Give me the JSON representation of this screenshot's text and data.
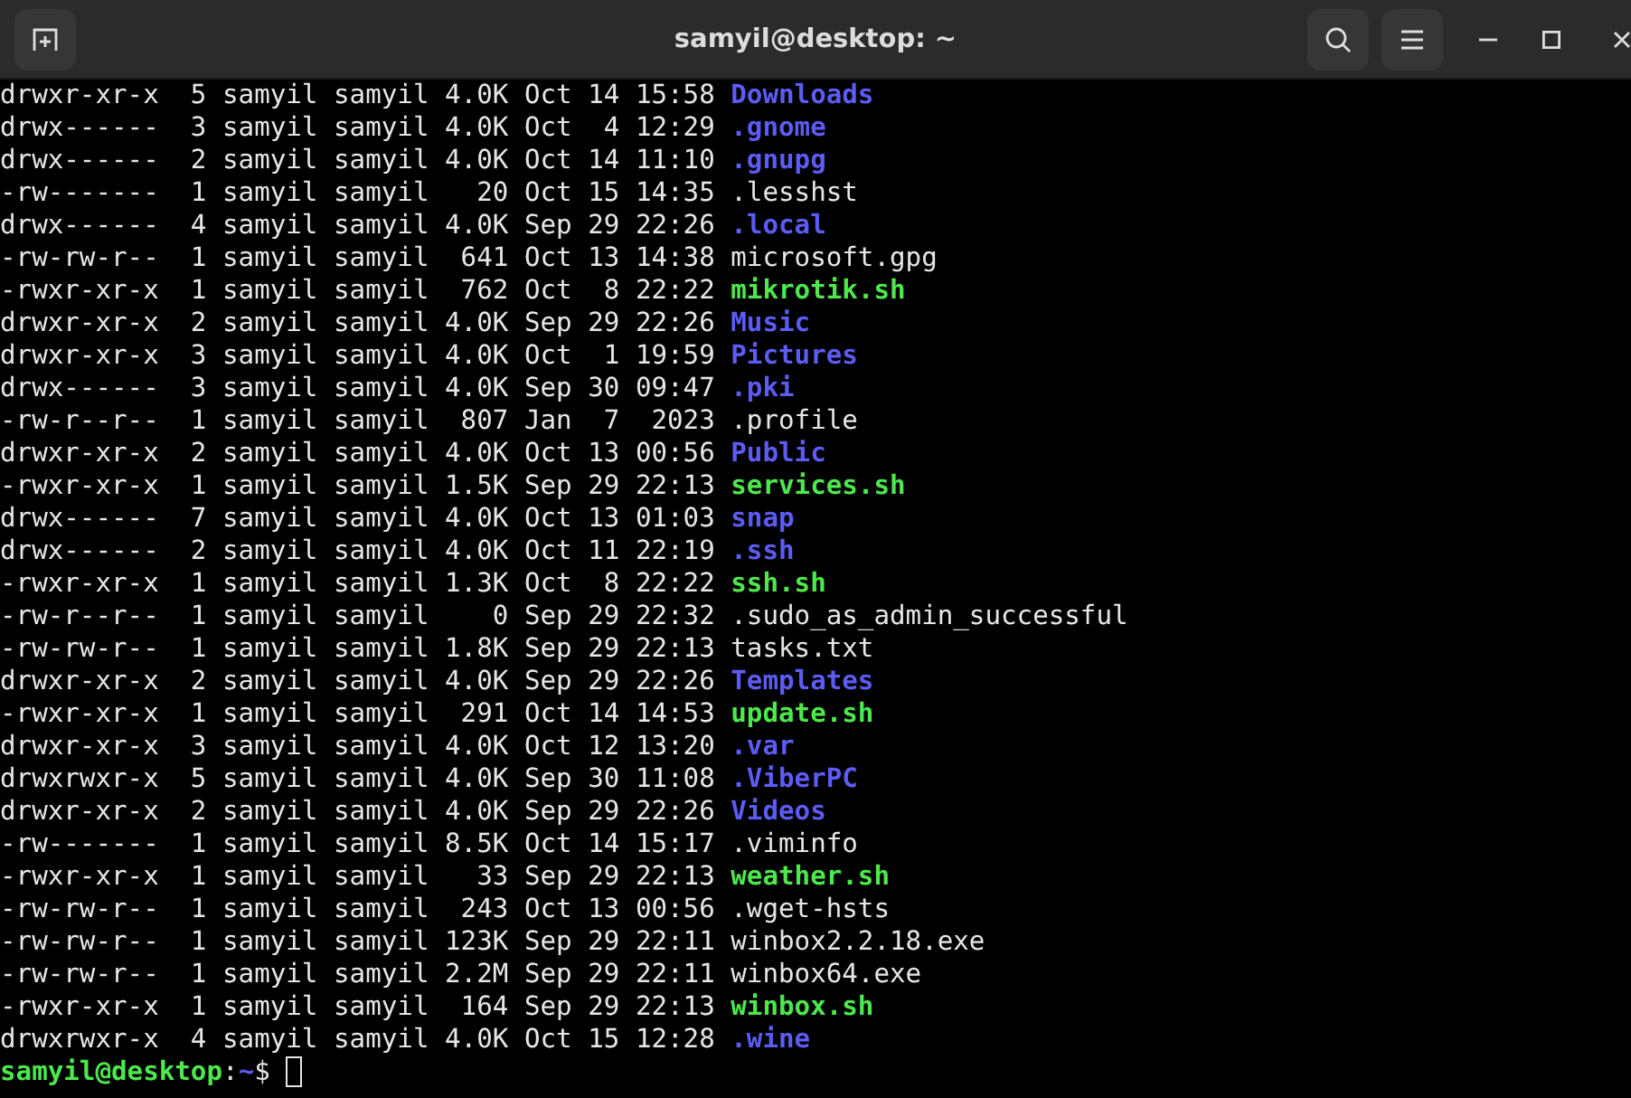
{
  "window": {
    "title": "samyil@desktop: ~"
  },
  "lines": [
    {
      "info": "drwxr-xr-x  5 samyil samyil 4.0K Oct 14 15:58",
      "name": "Downloads",
      "kind": "dir"
    },
    {
      "info": "drwx------  3 samyil samyil 4.0K Oct  4 12:29",
      "name": ".gnome",
      "kind": "dir"
    },
    {
      "info": "drwx------  2 samyil samyil 4.0K Oct 14 11:10",
      "name": ".gnupg",
      "kind": "dir"
    },
    {
      "info": "-rw-------  1 samyil samyil   20 Oct 15 14:35",
      "name": ".lesshst",
      "kind": "file"
    },
    {
      "info": "drwx------  4 samyil samyil 4.0K Sep 29 22:26",
      "name": ".local",
      "kind": "dir"
    },
    {
      "info": "-rw-rw-r--  1 samyil samyil  641 Oct 13 14:38",
      "name": "microsoft.gpg",
      "kind": "file"
    },
    {
      "info": "-rwxr-xr-x  1 samyil samyil  762 Oct  8 22:22",
      "name": "mikrotik.sh",
      "kind": "exec"
    },
    {
      "info": "drwxr-xr-x  2 samyil samyil 4.0K Sep 29 22:26",
      "name": "Music",
      "kind": "dir"
    },
    {
      "info": "drwxr-xr-x  3 samyil samyil 4.0K Oct  1 19:59",
      "name": "Pictures",
      "kind": "dir"
    },
    {
      "info": "drwx------  3 samyil samyil 4.0K Sep 30 09:47",
      "name": ".pki",
      "kind": "dir"
    },
    {
      "info": "-rw-r--r--  1 samyil samyil  807 Jan  7  2023",
      "name": ".profile",
      "kind": "file"
    },
    {
      "info": "drwxr-xr-x  2 samyil samyil 4.0K Oct 13 00:56",
      "name": "Public",
      "kind": "dir"
    },
    {
      "info": "-rwxr-xr-x  1 samyil samyil 1.5K Sep 29 22:13",
      "name": "services.sh",
      "kind": "exec"
    },
    {
      "info": "drwx------  7 samyil samyil 4.0K Oct 13 01:03",
      "name": "snap",
      "kind": "dir"
    },
    {
      "info": "drwx------  2 samyil samyil 4.0K Oct 11 22:19",
      "name": ".ssh",
      "kind": "dir"
    },
    {
      "info": "-rwxr-xr-x  1 samyil samyil 1.3K Oct  8 22:22",
      "name": "ssh.sh",
      "kind": "exec"
    },
    {
      "info": "-rw-r--r--  1 samyil samyil    0 Sep 29 22:32",
      "name": ".sudo_as_admin_successful",
      "kind": "file"
    },
    {
      "info": "-rw-rw-r--  1 samyil samyil 1.8K Sep 29 22:13",
      "name": "tasks.txt",
      "kind": "file"
    },
    {
      "info": "drwxr-xr-x  2 samyil samyil 4.0K Sep 29 22:26",
      "name": "Templates",
      "kind": "dir"
    },
    {
      "info": "-rwxr-xr-x  1 samyil samyil  291 Oct 14 14:53",
      "name": "update.sh",
      "kind": "exec"
    },
    {
      "info": "drwxr-xr-x  3 samyil samyil 4.0K Oct 12 13:20",
      "name": ".var",
      "kind": "dir"
    },
    {
      "info": "drwxrwxr-x  5 samyil samyil 4.0K Sep 30 11:08",
      "name": ".ViberPC",
      "kind": "dir"
    },
    {
      "info": "drwxr-xr-x  2 samyil samyil 4.0K Sep 29 22:26",
      "name": "Videos",
      "kind": "dir"
    },
    {
      "info": "-rw-------  1 samyil samyil 8.5K Oct 14 15:17",
      "name": ".viminfo",
      "kind": "file"
    },
    {
      "info": "-rwxr-xr-x  1 samyil samyil   33 Sep 29 22:13",
      "name": "weather.sh",
      "kind": "exec"
    },
    {
      "info": "-rw-rw-r--  1 samyil samyil  243 Oct 13 00:56",
      "name": ".wget-hsts",
      "kind": "file"
    },
    {
      "info": "-rw-rw-r--  1 samyil samyil 123K Sep 29 22:11",
      "name": "winbox2.2.18.exe",
      "kind": "file"
    },
    {
      "info": "-rw-rw-r--  1 samyil samyil 2.2M Sep 29 22:11",
      "name": "winbox64.exe",
      "kind": "file"
    },
    {
      "info": "-rwxr-xr-x  1 samyil samyil  164 Sep 29 22:13",
      "name": "winbox.sh",
      "kind": "exec"
    },
    {
      "info": "drwxrwxr-x  4 samyil samyil 4.0K Oct 15 12:28",
      "name": ".wine",
      "kind": "dir"
    }
  ],
  "prompt": {
    "user_host": "samyil@desktop",
    "separator": ":",
    "path": "~",
    "symbol": "$"
  }
}
